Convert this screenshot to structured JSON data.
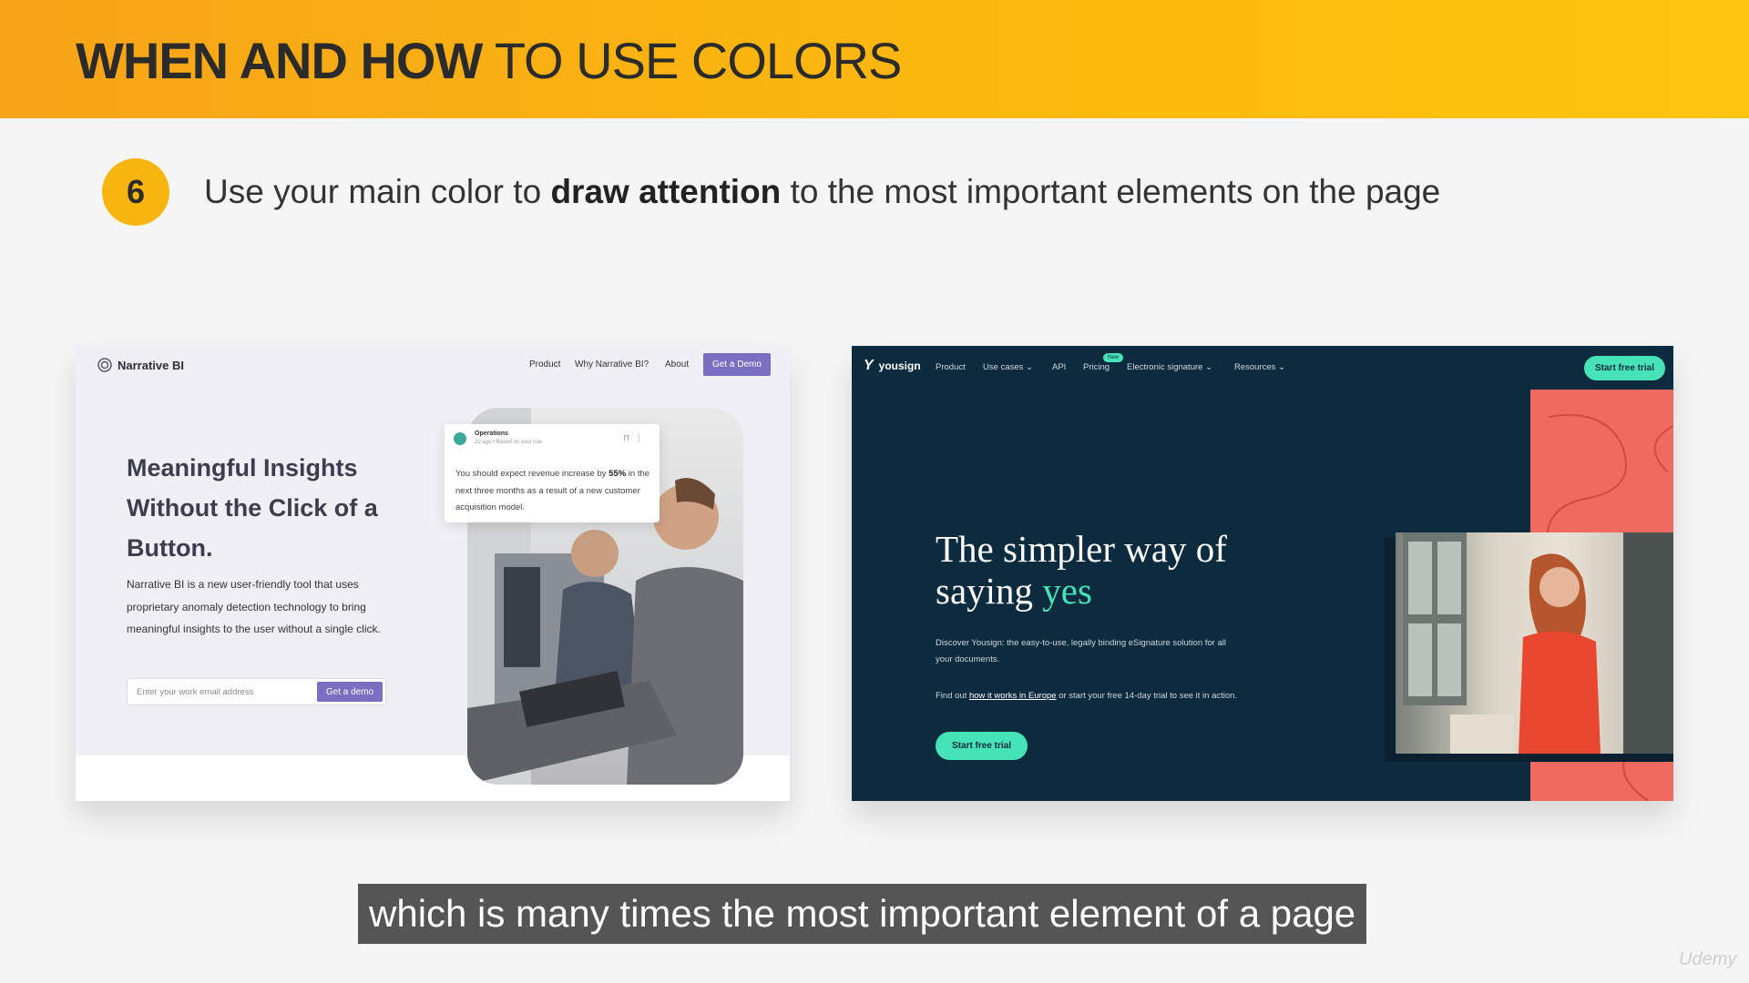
{
  "banner": {
    "title_strong": "WHEN AND HOW",
    "title_light": "TO USE COLORS",
    "color": "#fbb70f"
  },
  "step": {
    "number": "6",
    "text_before": "Use your main color to",
    "text_bold": "draw attention",
    "text_after": "to the most important elements on the page"
  },
  "narrative_bi": {
    "logo_icon": "target-icon",
    "logo": "Narrative BI",
    "nav": [
      "Product",
      "Why Narrative BI?",
      "About"
    ],
    "nav_cta": "Get a Demo",
    "headline": "Meaningful Insights Without the Click of a Button.",
    "body": "Narrative BI is a new user-friendly tool that uses proprietary anomaly detection technology to bring meaningful insights to the user without a single click.",
    "email_placeholder": "Enter your work email address",
    "email_button": "Get a demo",
    "card": {
      "title": "Operations",
      "meta": "2d ago • Based on your role",
      "body_before": "You should expect revenue increase by",
      "body_bold": "55%",
      "body_after": "in the next three months as a result of a new customer acquisition model."
    },
    "accent_color": "#7b6fc4"
  },
  "yousign": {
    "logo_mark": "Y",
    "logo": "yousign",
    "nav": [
      "Product",
      "Use cases ⌄",
      "API",
      "Pricing",
      "Electronic signature ⌄",
      "Resources ⌄"
    ],
    "new_badge": "New",
    "nav_cta": "Start free trial",
    "headline_before": "The simpler way of saying",
    "headline_accent": "yes",
    "paragraph1": "Discover Yousign: the easy-to-use, legally binding eSignature solution for all your documents.",
    "paragraph2_before": "Find out",
    "paragraph2_link": "how it works in Europe",
    "paragraph2_after": "or start your free 14-day trial to see it in action.",
    "cta": "Start free trial",
    "accent_color": "#46e3b7",
    "background_color": "#0d2b3e",
    "coral_color": "#ef6b5f"
  },
  "caption": "which is many times the most important element of a page",
  "watermark": "Udemy"
}
